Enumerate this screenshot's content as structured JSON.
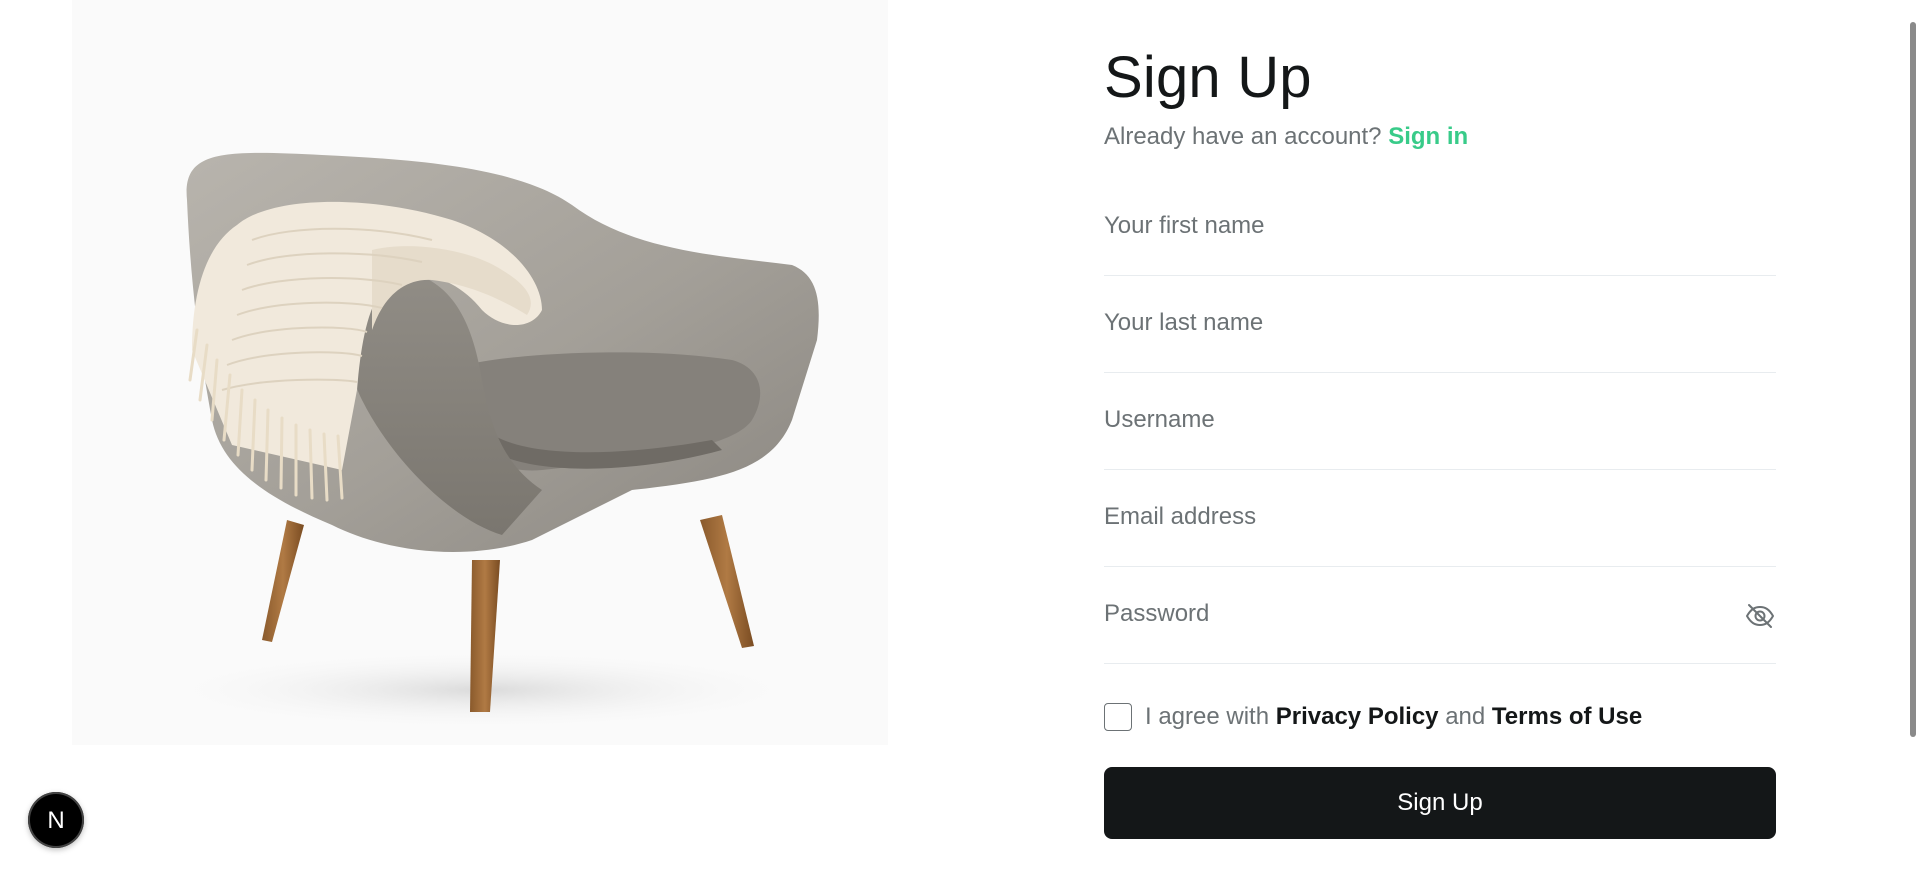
{
  "form": {
    "title": "Sign Up",
    "subline_prefix": "Already have an account?",
    "signin_link": "Sign in",
    "fields": {
      "first_name": {
        "placeholder": "Your first name",
        "value": ""
      },
      "last_name": {
        "placeholder": "Your last name",
        "value": ""
      },
      "username": {
        "placeholder": "Username",
        "value": ""
      },
      "email": {
        "placeholder": "Email address",
        "value": ""
      },
      "password": {
        "placeholder": "Password",
        "value": ""
      }
    },
    "agree": {
      "prefix": "I agree with",
      "privacy": "Privacy Policy",
      "and": "and",
      "terms": "Terms of Use",
      "checked": false
    },
    "submit_label": "Sign Up"
  },
  "dev_badge": {
    "label": "N"
  },
  "colors": {
    "accent": "#38cb89",
    "text_primary": "#141718",
    "text_secondary": "#6c7275",
    "divider": "#e8ecef",
    "button_bg": "#141718"
  },
  "icons": {
    "password_toggle": "eye-off-icon",
    "dev_badge": "nextjs-logo-icon"
  }
}
